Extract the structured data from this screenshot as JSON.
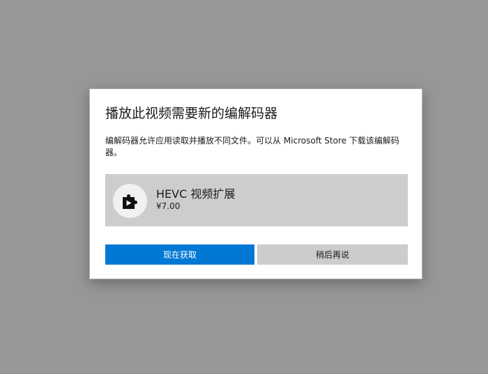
{
  "dialog": {
    "title": "播放此视频需要新的编解码器",
    "description": "编解码器允许应用读取并播放不同文件。可以从 Microsoft Store 下载该编解码器。",
    "extension": {
      "icon": "puzzle-play-icon",
      "name": "HEVC 视频扩展",
      "price": "¥7.00"
    },
    "buttons": {
      "get_now": "现在获取",
      "later": "稍后再说"
    }
  },
  "colors": {
    "overlay": "#979797",
    "accent": "#0078d4",
    "card": "#cdcdcd",
    "secondary_button": "#cccccc"
  }
}
